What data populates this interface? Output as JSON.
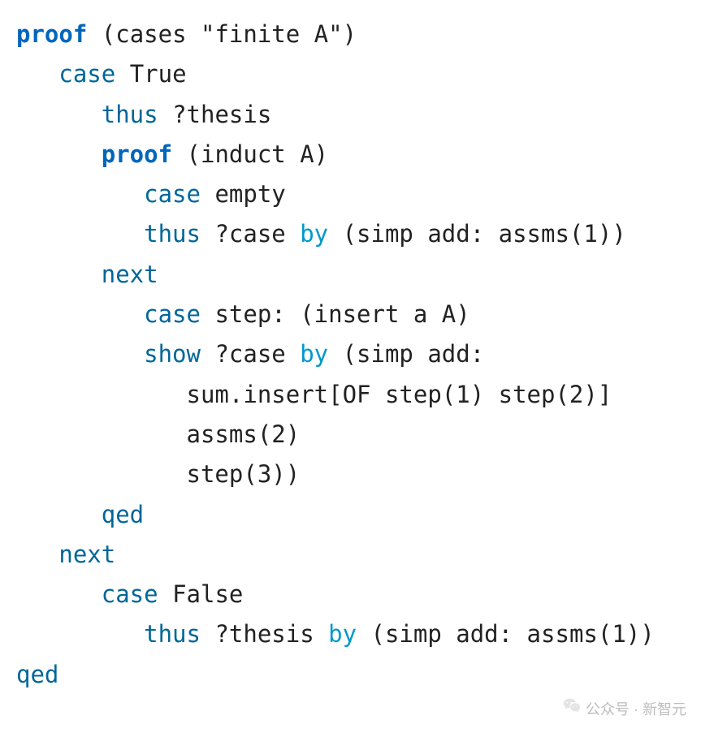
{
  "code": {
    "lines": [
      {
        "indent": 0,
        "tokens": [
          {
            "cls": "kw-bold",
            "t": "proof"
          },
          {
            "cls": "plain",
            "t": " (cases \"finite A\")"
          }
        ]
      },
      {
        "indent": 1,
        "tokens": [
          {
            "cls": "kw",
            "t": "case"
          },
          {
            "cls": "plain",
            "t": " True"
          }
        ]
      },
      {
        "indent": 2,
        "tokens": [
          {
            "cls": "kw",
            "t": "thus"
          },
          {
            "cls": "plain",
            "t": " ?thesis"
          }
        ]
      },
      {
        "indent": 2,
        "tokens": [
          {
            "cls": "kw-bold",
            "t": "proof"
          },
          {
            "cls": "plain",
            "t": " (induct A)"
          }
        ]
      },
      {
        "indent": 3,
        "tokens": [
          {
            "cls": "kw",
            "t": "case"
          },
          {
            "cls": "plain",
            "t": " empty"
          }
        ]
      },
      {
        "indent": 3,
        "tokens": [
          {
            "cls": "kw",
            "t": "thus"
          },
          {
            "cls": "plain",
            "t": " ?case "
          },
          {
            "cls": "kw-by",
            "t": "by"
          },
          {
            "cls": "plain",
            "t": " (simp add: assms(1))"
          }
        ]
      },
      {
        "indent": 2,
        "tokens": [
          {
            "cls": "kw",
            "t": "next"
          }
        ]
      },
      {
        "indent": 3,
        "tokens": [
          {
            "cls": "kw",
            "t": "case"
          },
          {
            "cls": "plain",
            "t": " step: (insert a A)"
          }
        ]
      },
      {
        "indent": 3,
        "tokens": [
          {
            "cls": "kw",
            "t": "show"
          },
          {
            "cls": "plain",
            "t": " ?case "
          },
          {
            "cls": "kw-by",
            "t": "by"
          },
          {
            "cls": "plain",
            "t": " (simp add:"
          }
        ]
      },
      {
        "indent": 4,
        "tokens": [
          {
            "cls": "plain",
            "t": "sum.insert[OF step(1) step(2)]"
          }
        ]
      },
      {
        "indent": 4,
        "tokens": [
          {
            "cls": "plain",
            "t": "assms(2)"
          }
        ]
      },
      {
        "indent": 4,
        "tokens": [
          {
            "cls": "plain",
            "t": "step(3))"
          }
        ]
      },
      {
        "indent": 2,
        "tokens": [
          {
            "cls": "kw",
            "t": "qed"
          }
        ]
      },
      {
        "indent": 1,
        "tokens": [
          {
            "cls": "kw",
            "t": "next"
          }
        ]
      },
      {
        "indent": 2,
        "tokens": [
          {
            "cls": "kw",
            "t": "case"
          },
          {
            "cls": "plain",
            "t": " False"
          }
        ]
      },
      {
        "indent": 3,
        "tokens": [
          {
            "cls": "kw",
            "t": "thus"
          },
          {
            "cls": "plain",
            "t": " ?thesis "
          },
          {
            "cls": "kw-by",
            "t": "by"
          },
          {
            "cls": "plain",
            "t": " (simp add: assms(1))"
          }
        ]
      },
      {
        "indent": 0,
        "tokens": [
          {
            "cls": "kw",
            "t": "qed"
          }
        ]
      }
    ],
    "indent_unit": "   "
  },
  "watermark": {
    "text": "公众号 · 新智元"
  }
}
